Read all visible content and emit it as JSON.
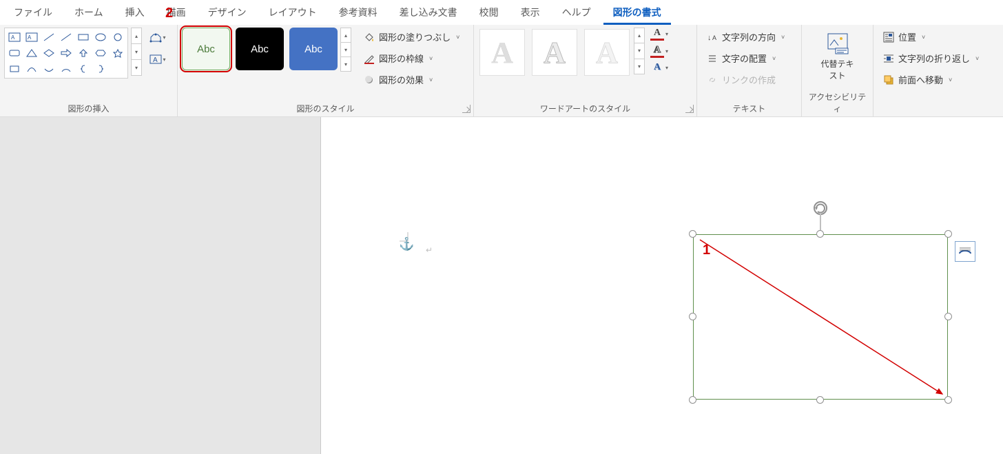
{
  "tabs": {
    "file": "ファイル",
    "home": "ホーム",
    "insert": "挿入",
    "draw": "描画",
    "design": "デザイン",
    "layout": "レイアウト",
    "references": "参考資料",
    "mailmerge": "差し込み文書",
    "review": "校閲",
    "view": "表示",
    "help": "ヘルプ",
    "shapeformat": "図形の書式"
  },
  "groups": {
    "insert_shapes": "図形の挿入",
    "shape_styles": "図形のスタイル",
    "wordart_styles": "ワードアートのスタイル",
    "text": "テキスト",
    "accessibility": "アクセシビリティ",
    "arrange": ""
  },
  "style_thumbs": {
    "abc": "Abc"
  },
  "wordart_thumbs": {
    "A": "A"
  },
  "commands": {
    "shape_fill": "図形の塗りつぶし",
    "shape_outline": "図形の枠線",
    "shape_effects": "図形の効果",
    "text_direction": "文字列の方向",
    "text_align": "文字の配置",
    "create_link": "リンクの作成",
    "alt_text": "代替テキスト",
    "position": "位置",
    "text_wrap": "文字列の折り返し",
    "bring_forward": "前面へ移動"
  },
  "annotations": {
    "n1": "1",
    "n2": "2"
  },
  "colors": {
    "accent": "#2b579a",
    "handle": "#8f8f8f",
    "shape_border": "#5f8f4c",
    "highlight": "#d20000"
  }
}
